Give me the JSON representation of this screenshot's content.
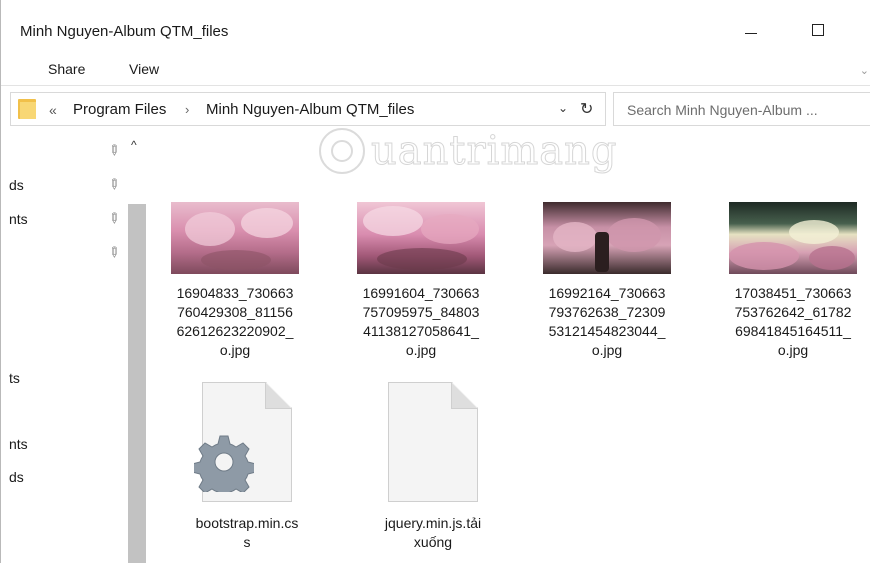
{
  "window": {
    "title": "Minh Nguyen-Album QTM_files"
  },
  "ribbon": {
    "tabs": [
      "Share",
      "View"
    ]
  },
  "address": {
    "up_glyph": "«",
    "crumbs": [
      "Program Files",
      "Minh Nguyen-Album QTM_files"
    ],
    "separator": "›",
    "dropdown_glyph": "⌄",
    "refresh_glyph": "↻"
  },
  "search": {
    "placeholder": "Search Minh Nguyen-Album ..."
  },
  "nav": {
    "scroll_up_glyph": "^",
    "items": [
      "ds",
      "nts",
      "ts",
      "nts",
      "ds"
    ]
  },
  "watermark": {
    "text": "uantrimang"
  },
  "files": [
    {
      "name": "16904833_730663760429308_8115662612623220902_o.jpg",
      "label_lines": [
        "16904833_730663",
        "760429308_81156",
        "62612623220902_",
        "o.jpg"
      ],
      "kind": "image"
    },
    {
      "name": "16991604_730663757095975_8480341138127058641_o.jpg",
      "label_lines": [
        "16991604_730663",
        "757095975_84803",
        "41138127058641_",
        "o.jpg"
      ],
      "kind": "image"
    },
    {
      "name": "16992164_730663793762638_7230953121454823044_o.jpg",
      "label_lines": [
        "16992164_730663",
        "793762638_72309",
        "53121454823044_",
        "o.jpg"
      ],
      "kind": "image"
    },
    {
      "name": "17038451_730663753762642_6178269841845164511_o.jpg",
      "label_lines": [
        "17038451_730663",
        "753762642_61782",
        "69841845164511_",
        "o.jpg"
      ],
      "kind": "image"
    },
    {
      "name": "bootstrap.min.css",
      "label_lines": [
        "bootstrap.min.cs",
        "s"
      ],
      "kind": "css"
    },
    {
      "name": "jquery.min.js.tải xuống",
      "label_lines": [
        "jquery.min.js.tải",
        "xuống"
      ],
      "kind": "file"
    }
  ]
}
